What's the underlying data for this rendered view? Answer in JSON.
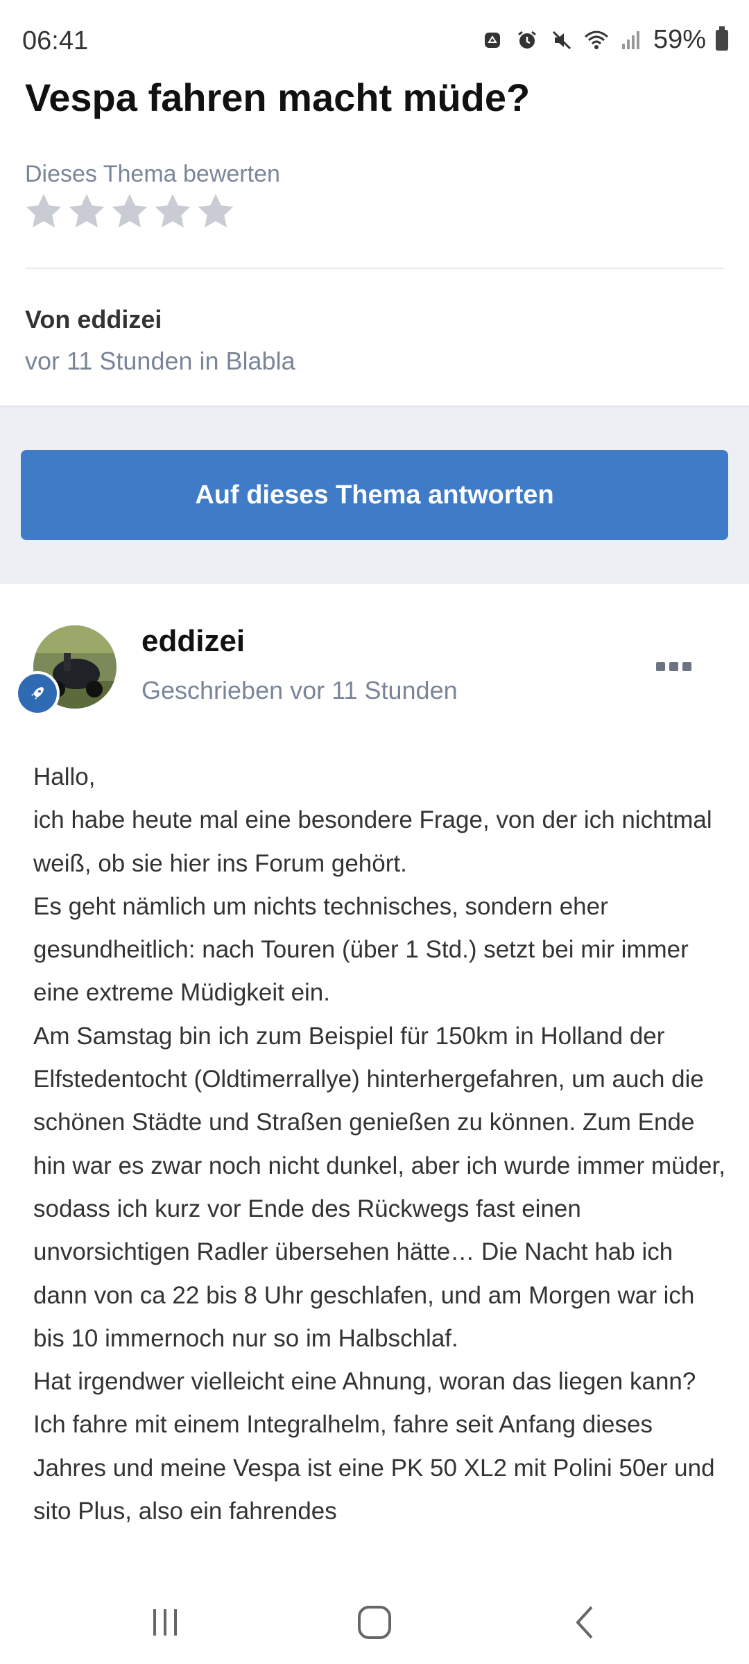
{
  "status_bar": {
    "time": "06:41",
    "battery_percent": "59%",
    "icons": [
      "recycle-icon",
      "alarm-icon",
      "mute-icon",
      "wifi-icon",
      "signal-icon",
      "battery-icon"
    ]
  },
  "topic": {
    "title": "Vespa fahren macht müde?",
    "rating_label": "Dieses Thema bewerten",
    "rating_value": 0,
    "rating_max": 5,
    "author_label": "Von eddizei",
    "author_meta": "vor 11 Stunden in Blabla"
  },
  "reply_button": {
    "label": "Auf dieses Thema antworten"
  },
  "post": {
    "author": "eddizei",
    "time": "Geschrieben vor 11 Stunden",
    "body": [
      "Hallo,",
      "ich habe heute mal eine besondere Frage, von der ich nichtmal weiß, ob sie hier ins Forum gehört.",
      "Es geht nämlich um nichts technisches, sondern eher gesundheitlich: nach  Touren (über 1 Std.) setzt bei mir immer eine extreme Müdigkeit ein.",
      "Am Samstag bin ich zum Beispiel für 150km in Holland der Elfstedentocht (Oldtimerrallye) hinterhergefahren, um auch die schönen Städte und Straßen genießen zu können. Zum Ende hin war es zwar noch nicht dunkel, aber ich wurde immer müder, sodass ich kurz vor Ende des Rückwegs fast einen unvorsichtigen Radler übersehen hätte…  Die Nacht hab ich dann von ca 22 bis 8 Uhr geschlafen, und am Morgen war ich bis 10 immernoch nur so im Halbschlaf.",
      "Hat irgendwer vielleicht eine Ahnung, woran das liegen kann? Ich fahre mit einem Integralhelm, fahre seit Anfang dieses Jahres und meine Vespa ist eine PK 50 XL2 mit Polini 50er und sito Plus, also ein fahrendes"
    ]
  },
  "nav_bar": {
    "icons": [
      "recent-apps-icon",
      "home-icon",
      "back-icon"
    ]
  },
  "colors": {
    "accent": "#3f7bc6",
    "muted_text": "#7a8599",
    "band_bg": "#eceff3",
    "badge": "#2f6bb3"
  }
}
